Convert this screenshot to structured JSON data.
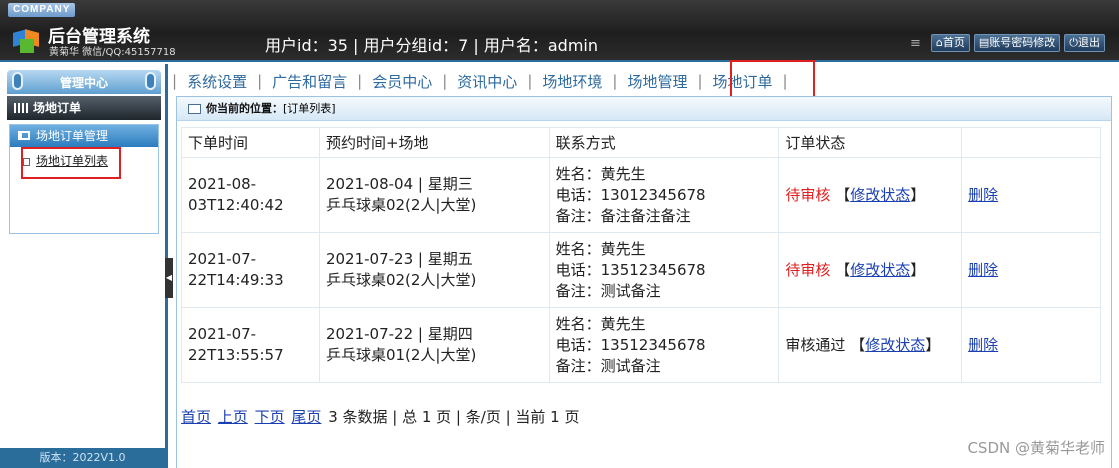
{
  "header": {
    "company": "COMPANY",
    "title": "后台管理系统",
    "subtitle": "黄菊华 微信/QQ:45157718",
    "user_info": "用户id：35 | 用户分组id：7 | 用户名：admin",
    "buttons": [
      "首页",
      "账号密码修改",
      "退出"
    ]
  },
  "sidebar": {
    "title": "管理中心",
    "section": "场地订单",
    "group": "场地订单管理",
    "link": "场地订单列表",
    "version": "版本：2022V1.0"
  },
  "nav": {
    "items": [
      "系统设置",
      "广告和留言",
      "会员中心",
      "资讯中心",
      "场地环境",
      "场地管理",
      "场地订单"
    ],
    "active": "场地订单"
  },
  "breadcrumb": {
    "prefix": "你当前的位置：",
    "current": "[订单列表]"
  },
  "table": {
    "headers": [
      "下单时间",
      "预约时间+场地",
      "联系方式",
      "订单状态",
      ""
    ],
    "rows": [
      {
        "time": [
          "2021-08-",
          "03T12:40:42"
        ],
        "booking": [
          "2021-08-04 | 星期三",
          "乒乓球桌02(2人|大堂)"
        ],
        "contact": [
          "姓名：黄先生",
          "电话：13012345678",
          "备注：备注备注备注"
        ],
        "status": "待审核",
        "pending": true,
        "edit": "修改状态",
        "delete": "删除"
      },
      {
        "time": [
          "2021-07-",
          "22T14:49:33"
        ],
        "booking": [
          "2021-07-23 | 星期五",
          "乒乓球桌02(2人|大堂)"
        ],
        "contact": [
          "姓名：黄先生",
          "电话：13512345678",
          "备注：测试备注"
        ],
        "status": "待审核",
        "pending": true,
        "edit": "修改状态",
        "delete": "删除"
      },
      {
        "time": [
          "2021-07-",
          "22T13:55:57"
        ],
        "booking": [
          "2021-07-22 | 星期四",
          "乒乓球桌01(2人|大堂)"
        ],
        "contact": [
          "姓名：黄先生",
          "电话：13512345678",
          "备注：测试备注"
        ],
        "status": "审核通过",
        "pending": false,
        "edit": "修改状态",
        "delete": "删除"
      }
    ]
  },
  "pager": {
    "first": "首页",
    "prev": "上页",
    "next": "下页",
    "last": "尾页",
    "summary": "3 条数据 | 总 1 页 | 条/页 | 当前 1 页"
  },
  "watermark": "CSDN @黄菊华老师",
  "colors": {
    "accent": "#2a6c9a",
    "pending": "#e02020",
    "link": "#1a3fb0"
  }
}
